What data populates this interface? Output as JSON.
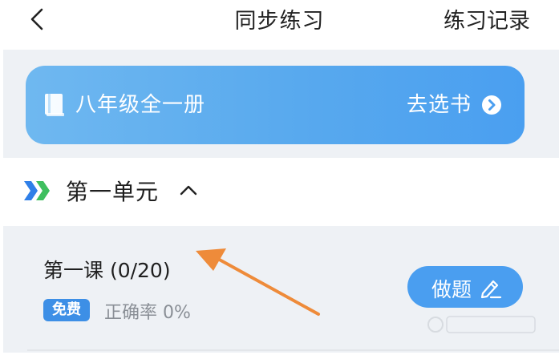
{
  "header": {
    "title": "同步练习",
    "record_label": "练习记录"
  },
  "banner": {
    "book_title": "八年级全一册",
    "pick_book_label": "去选书"
  },
  "unit": {
    "title": "第一单元"
  },
  "lesson": {
    "title": "第一课 (0/20)",
    "free_badge": "免费",
    "accuracy": "正确率 0%",
    "action_label": "做题"
  },
  "colors": {
    "accent": "#4a9ef0",
    "annotation_arrow": "#ee8b3a",
    "card_bg": "#eef1f5"
  },
  "icons": {
    "back": "chevron-left-icon",
    "book": "book-icon",
    "arrow": "arrow-right-circle-icon",
    "unit": "double-chevron-icon",
    "caret": "chevron-up-icon",
    "pen": "edit-pen-icon"
  }
}
